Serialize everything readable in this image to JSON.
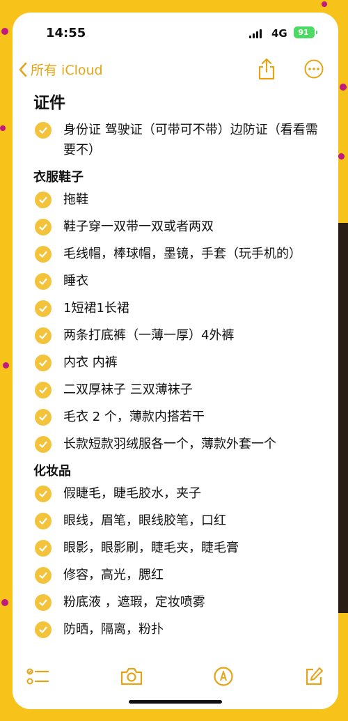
{
  "status_bar": {
    "time": "14:55",
    "network": "4G",
    "battery": "91"
  },
  "nav": {
    "back_label": "所有 iCloud"
  },
  "note": {
    "title": "证件",
    "title_items": [
      {
        "text": "身份证 驾驶证（可带可不带）边防证（看看需要不）",
        "checked": true
      }
    ],
    "sections": [
      {
        "heading": "衣服鞋子",
        "items": [
          {
            "text": "拖鞋",
            "checked": true
          },
          {
            "text": "鞋子穿一双带一双或者两双",
            "checked": true
          },
          {
            "text": "毛线帽，棒球帽，墨镜，手套（玩手机的）",
            "checked": true
          },
          {
            "text": "睡衣",
            "checked": true
          },
          {
            "text": "1短裙1长裙",
            "checked": true
          },
          {
            "text": "两条打底裤（一薄一厚）4外裤",
            "checked": true
          },
          {
            "text": "内衣 内裤",
            "checked": true
          },
          {
            "text": "二双厚袜子 三双薄袜子",
            "checked": true
          },
          {
            "text": "毛衣 2 个，薄款内搭若干",
            "checked": true
          },
          {
            "text": "长款短款羽绒服各一个，薄款外套一个",
            "checked": true
          }
        ]
      },
      {
        "heading": "化妆品",
        "items": [
          {
            "text": "假睫毛，睫毛胶水，夹子",
            "checked": true
          },
          {
            "text": "眼线，眉笔，眼线胶笔，口红",
            "checked": true
          },
          {
            "text": "眼影，眼影刷，睫毛夹，睫毛膏",
            "checked": true
          },
          {
            "text": "修容，高光，腮红",
            "checked": true
          },
          {
            "text": "粉底液 ，遮瑕，定妆喷雾",
            "checked": true
          },
          {
            "text": "防晒，隔离，粉扑",
            "checked": true
          }
        ]
      }
    ]
  },
  "toolbar": {
    "icons": [
      "checklist-icon",
      "camera-icon",
      "markup-icon",
      "compose-icon"
    ]
  },
  "colors": {
    "accent": "#e4a416",
    "check": "#f3c33c",
    "background": "#f7c21a"
  }
}
